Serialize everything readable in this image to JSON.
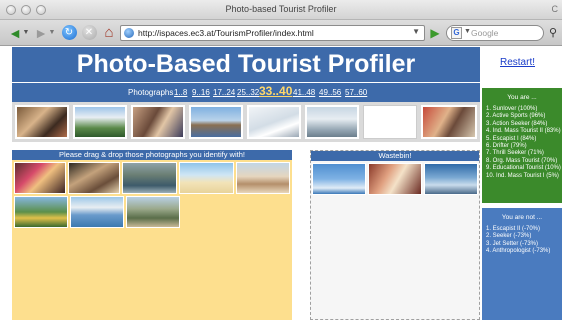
{
  "window": {
    "title": "Photo-based Tourist Profiler",
    "right_char": "C"
  },
  "toolbar": {
    "url": "http://ispaces.ec3.at/TourismProfiler/index.html",
    "search_placeholder": "Google",
    "search_engine": "G"
  },
  "page": {
    "title": "Photo-Based Tourist Profiler",
    "restart": "Restart!",
    "photos_label": "Photographs",
    "pages": [
      {
        "label": "1..8",
        "current": false
      },
      {
        "label": "9..16",
        "current": false
      },
      {
        "label": "17..24",
        "current": false
      },
      {
        "label": "25..32",
        "current": false
      },
      {
        "label": "33..40",
        "current": true
      },
      {
        "label": "41..48",
        "current": false
      },
      {
        "label": "49..56",
        "current": false
      },
      {
        "label": "57..60",
        "current": false
      }
    ],
    "dropzone_title": "Please drag & drop those photographs you identify with!",
    "wastebin_title": "Wastebin!"
  },
  "you_are": {
    "title": "You are ...",
    "items": [
      "1. Sunlover (100%)",
      "2. Active Sports (96%)",
      "3. Action Seeker (84%)",
      "4. Ind. Mass Tourist II (83%)",
      "5. Escapist I (84%)",
      "6. Drifter (79%)",
      "7. Thrill Seeker (71%)",
      "8. Org. Mass Tourist (70%)",
      "9. Educational Tourist (10%)",
      "10. Ind. Mass Tourist I (5%)"
    ]
  },
  "you_are_not": {
    "title": "You are not ...",
    "items": [
      "1. Escapist II (-70%)",
      "2. Seeker (-73%)",
      "3. Jet Setter (-73%)",
      "4. Anthropologist (-73%)"
    ]
  },
  "colors": {
    "header_blue": "#3d6aaa",
    "dropzone": "#fddf8e",
    "you_are_bg": "#3b8a2b",
    "you_are_not_bg": "#4a7bbf"
  },
  "icons": [
    "back-arrow-icon",
    "forward-arrow-icon",
    "reload-icon",
    "stop-icon",
    "home-icon",
    "page-favicon",
    "go-arrow-icon",
    "search-magnifier-icon"
  ]
}
